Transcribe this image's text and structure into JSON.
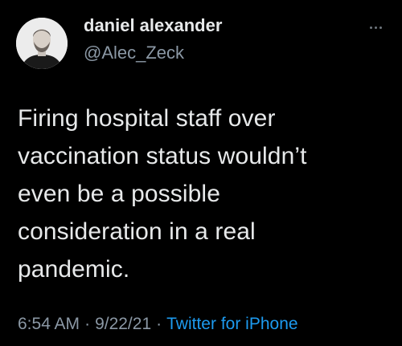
{
  "tweet": {
    "display_name": "daniel alexander",
    "handle": "@Alec_Zeck",
    "body": "Firing hospital staff over\nvaccination status wouldn’t\neven be a possible\nconsideration in a real\npandemic.",
    "time": "6:54 AM",
    "date": "9/22/21",
    "separator": "·",
    "source": "Twitter for iPhone"
  },
  "icons": {
    "more": "more-horizontal-icon",
    "avatar": "user-avatar"
  },
  "colors": {
    "background": "#000000",
    "text": "#e7e9ea",
    "muted": "#8b98a5",
    "link": "#1d9bf0"
  }
}
